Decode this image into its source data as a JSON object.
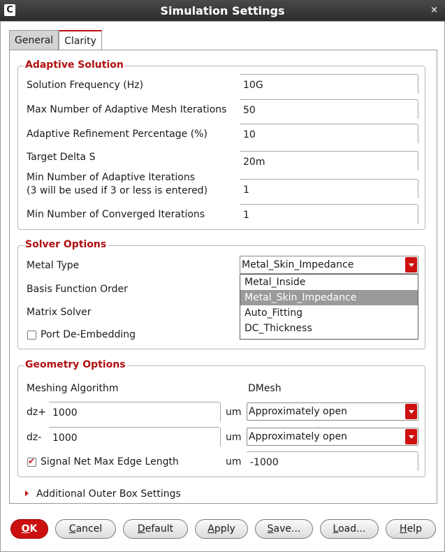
{
  "window": {
    "title": "Simulation Settings",
    "app_icon": "C",
    "close_glyph": "×"
  },
  "tabs": [
    {
      "label": "General"
    },
    {
      "label": "Clarity"
    }
  ],
  "adaptive": {
    "legend": "Adaptive Solution",
    "rows": [
      {
        "label": "Solution Frequency (Hz)",
        "value": "10G"
      },
      {
        "label": "Max Number of Adaptive Mesh Iterations",
        "value": "50"
      },
      {
        "label": "Adaptive Refinement Percentage (%)",
        "value": "10"
      },
      {
        "label": "Target Delta S",
        "value": "20m"
      },
      {
        "label": "Min Number of Adaptive Iterations",
        "label2": "(3 will be used if 3 or less is entered)",
        "value": "1"
      },
      {
        "label": "Min Number of Converged Iterations",
        "value": "1"
      }
    ]
  },
  "solver": {
    "legend": "Solver Options",
    "metal_type_label": "Metal Type",
    "metal_type_value": "Metal_Skin_Impedance",
    "basis_label": "Basis Function Order",
    "matrix_label": "Matrix Solver",
    "port_label": "Port De-Embedding",
    "port_checked": false,
    "options": [
      "Metal_Inside",
      "Metal_Skin_Impedance",
      "Auto_Fitting",
      "DC_Thickness"
    ],
    "highlighted_option": "Metal_Skin_Impedance"
  },
  "geometry": {
    "legend": "Geometry Options",
    "meshing_label": "Meshing Algorithm",
    "meshing_value": "DMesh",
    "dzplus_label": "dz+",
    "dzplus_value": "1000",
    "dzplus_unit": "um",
    "dzplus_mode": "Approximately open",
    "dzminus_label": "dz-",
    "dzminus_value": "1000",
    "dzminus_unit": "um",
    "dzminus_mode": "Approximately open",
    "signal_label": "Signal Net Max Edge Length",
    "signal_checked": true,
    "signal_unit": "um",
    "signal_value": "-1000"
  },
  "additional": {
    "label": "Additional Outer Box Settings"
  },
  "buttons": {
    "ok": {
      "mnemonic": "O",
      "rest": "K"
    },
    "cancel": {
      "mnemonic": "C",
      "rest": "ancel"
    },
    "default": {
      "mnemonic": "D",
      "rest": "efault"
    },
    "apply": {
      "mnemonic": "A",
      "rest": "pply"
    },
    "save": {
      "mnemonic": "S",
      "rest": "ave..."
    },
    "load": {
      "mnemonic": "L",
      "rest": "oad..."
    },
    "help": {
      "mnemonic": "H",
      "rest": "elp"
    }
  },
  "colors": {
    "accent": "#cc1010",
    "legend": "#b01010",
    "highlight": "#9a9a9a"
  }
}
